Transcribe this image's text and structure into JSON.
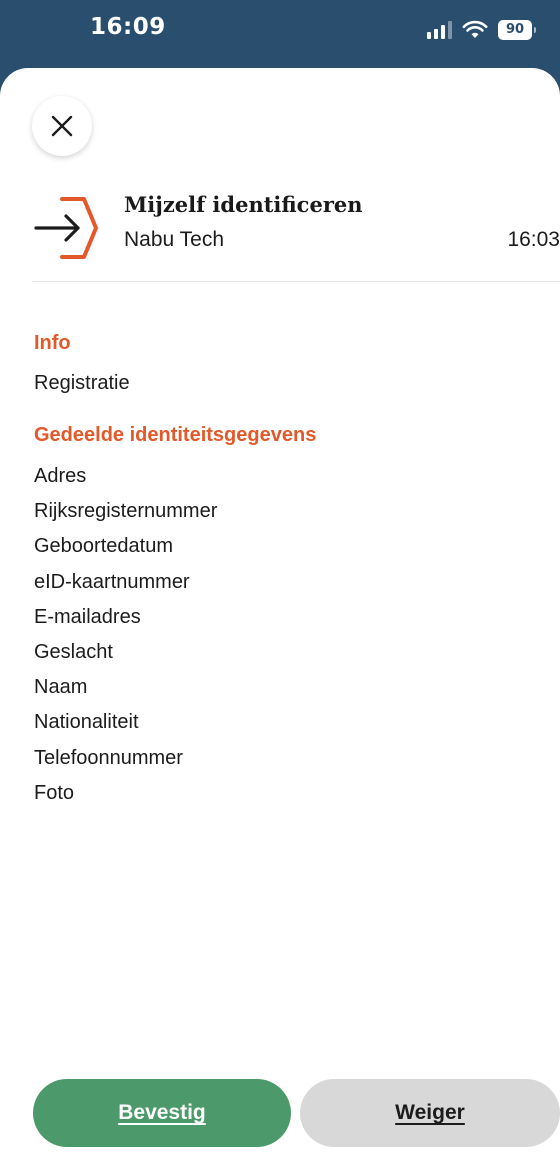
{
  "status_bar": {
    "time": "16:09",
    "battery": "90"
  },
  "close": {
    "label": "Sluiten"
  },
  "request": {
    "title": "Mijzelf identificeren",
    "organisation": "Nabu Tech",
    "time": "16:03"
  },
  "info": {
    "heading": "Info",
    "value": "Registratie"
  },
  "shared": {
    "heading": "Gedeelde identiteitsgegevens",
    "items": [
      "Adres",
      "Rijksregisternummer",
      "Geboortedatum",
      "eID-kaartnummer",
      "E-mailadres",
      "Geslacht",
      "Naam",
      "Nationaliteit",
      "Telefoonnummer",
      "Foto"
    ]
  },
  "actions": {
    "confirm": "Bevestig",
    "decline": "Weiger"
  },
  "colors": {
    "accent": "#e4592a",
    "confirm": "#4c9a6b",
    "decline": "#d8d8d8",
    "header": "#2a4e6e"
  }
}
